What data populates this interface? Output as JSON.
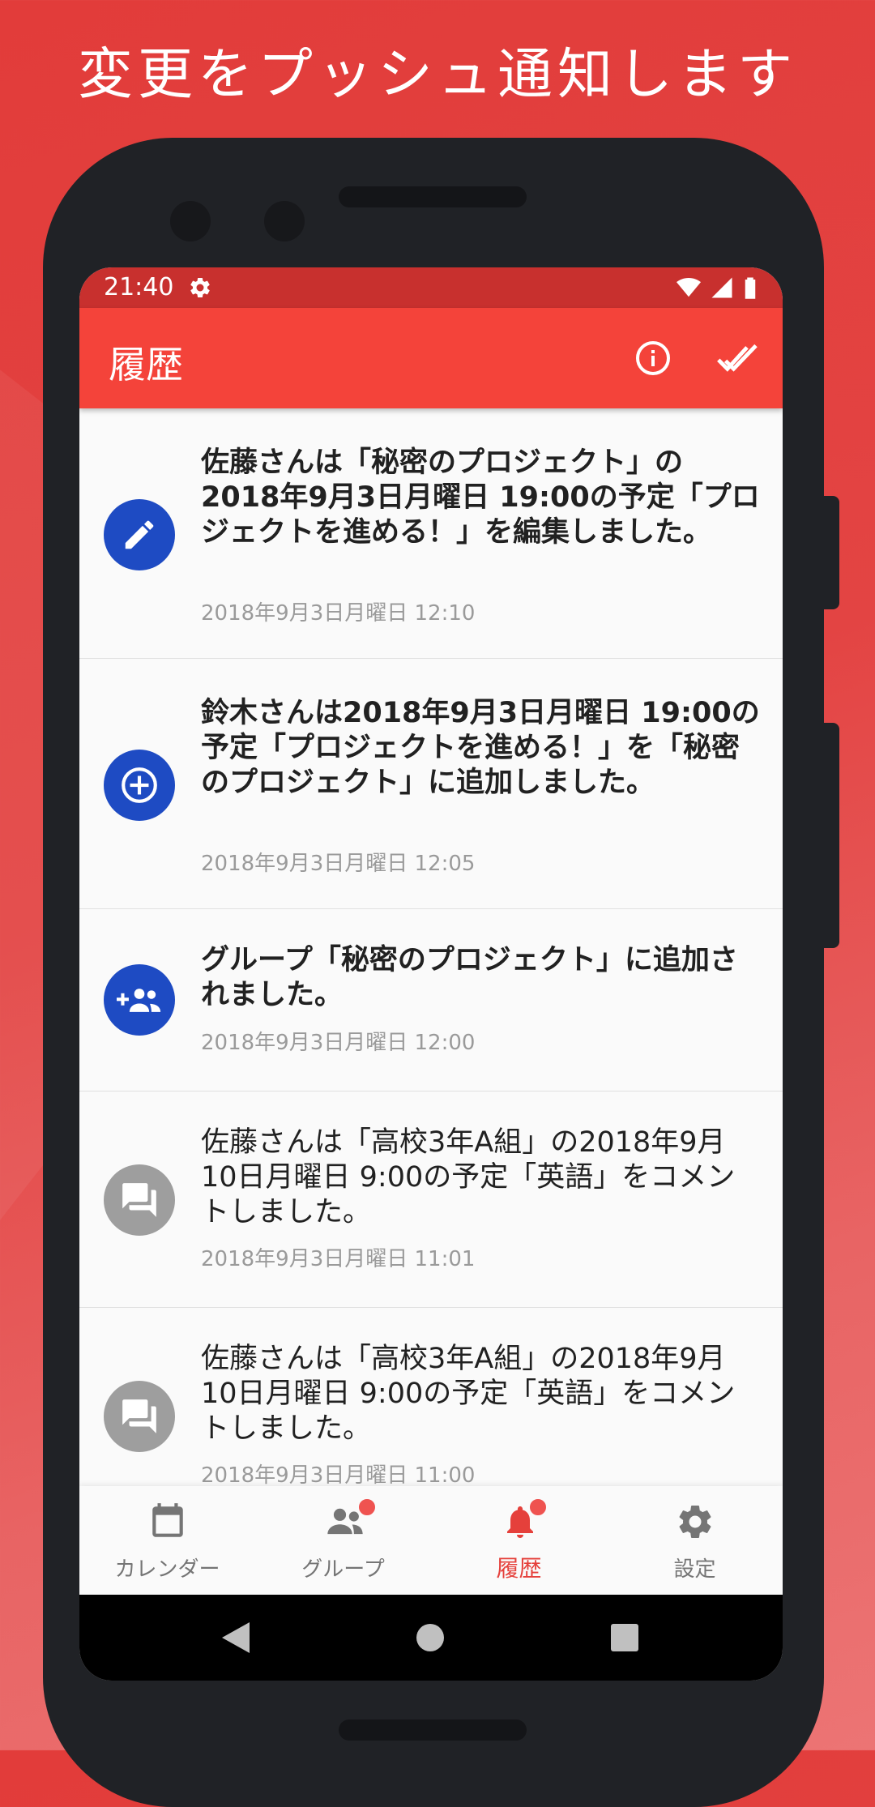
{
  "promo": {
    "title": "変更をプッシュ通知します"
  },
  "status_bar": {
    "time": "21:40",
    "icons": [
      "gear-icon",
      "wifi-icon",
      "signal-icon",
      "battery-icon"
    ]
  },
  "app_bar": {
    "title": "履歴",
    "actions": [
      "info-icon",
      "done-all-icon"
    ]
  },
  "history": [
    {
      "icon": "edit-icon",
      "icon_color": "#1e4bc3",
      "text": "佐藤さんは「秘密のプロジェクト」の2018年9月3日月曜日 19:00の予定「プロジェクトを進める！」を編集しました。",
      "time": "2018年9月3日月曜日 12:10",
      "unread": true
    },
    {
      "icon": "add-circle-icon",
      "icon_color": "#1e4bc3",
      "text": "鈴木さんは2018年9月3日月曜日 19:00の予定「プロジェクトを進める！」を「秘密のプロジェクト」に追加しました。",
      "time": "2018年9月3日月曜日 12:05",
      "unread": true
    },
    {
      "icon": "group-add-icon",
      "icon_color": "#1e4bc3",
      "text": "グループ「秘密のプロジェクト」に追加されました。",
      "time": "2018年9月3日月曜日 12:00",
      "unread": true
    },
    {
      "icon": "comment-icon",
      "icon_color": "#9e9e9e",
      "text": "佐藤さんは「高校3年A組」の2018年9月10日月曜日 9:00の予定「英語」をコメントしました。",
      "time": "2018年9月3日月曜日 11:01",
      "unread": false
    },
    {
      "icon": "comment-icon",
      "icon_color": "#9e9e9e",
      "text": "佐藤さんは「高校3年A組」の2018年9月10日月曜日 9:00の予定「英語」をコメントしました。",
      "time": "2018年9月3日月曜日 11:00",
      "unread": false
    }
  ],
  "bottom_nav": [
    {
      "label": "カレンダー",
      "icon": "calendar-icon",
      "active": false,
      "badge": false
    },
    {
      "label": "グループ",
      "icon": "group-icon",
      "active": false,
      "badge": true
    },
    {
      "label": "履歴",
      "icon": "bell-icon",
      "active": true,
      "badge": true
    },
    {
      "label": "設定",
      "icon": "gear-icon",
      "active": false,
      "badge": false
    }
  ],
  "system_nav": [
    "back-icon",
    "home-icon",
    "recents-icon"
  ],
  "colors": {
    "accent": "#f4433a",
    "status_bar": "#c8302e",
    "unread_icon": "#1e4bc3",
    "read_icon": "#9e9e9e",
    "active_tab": "#e5403b"
  }
}
